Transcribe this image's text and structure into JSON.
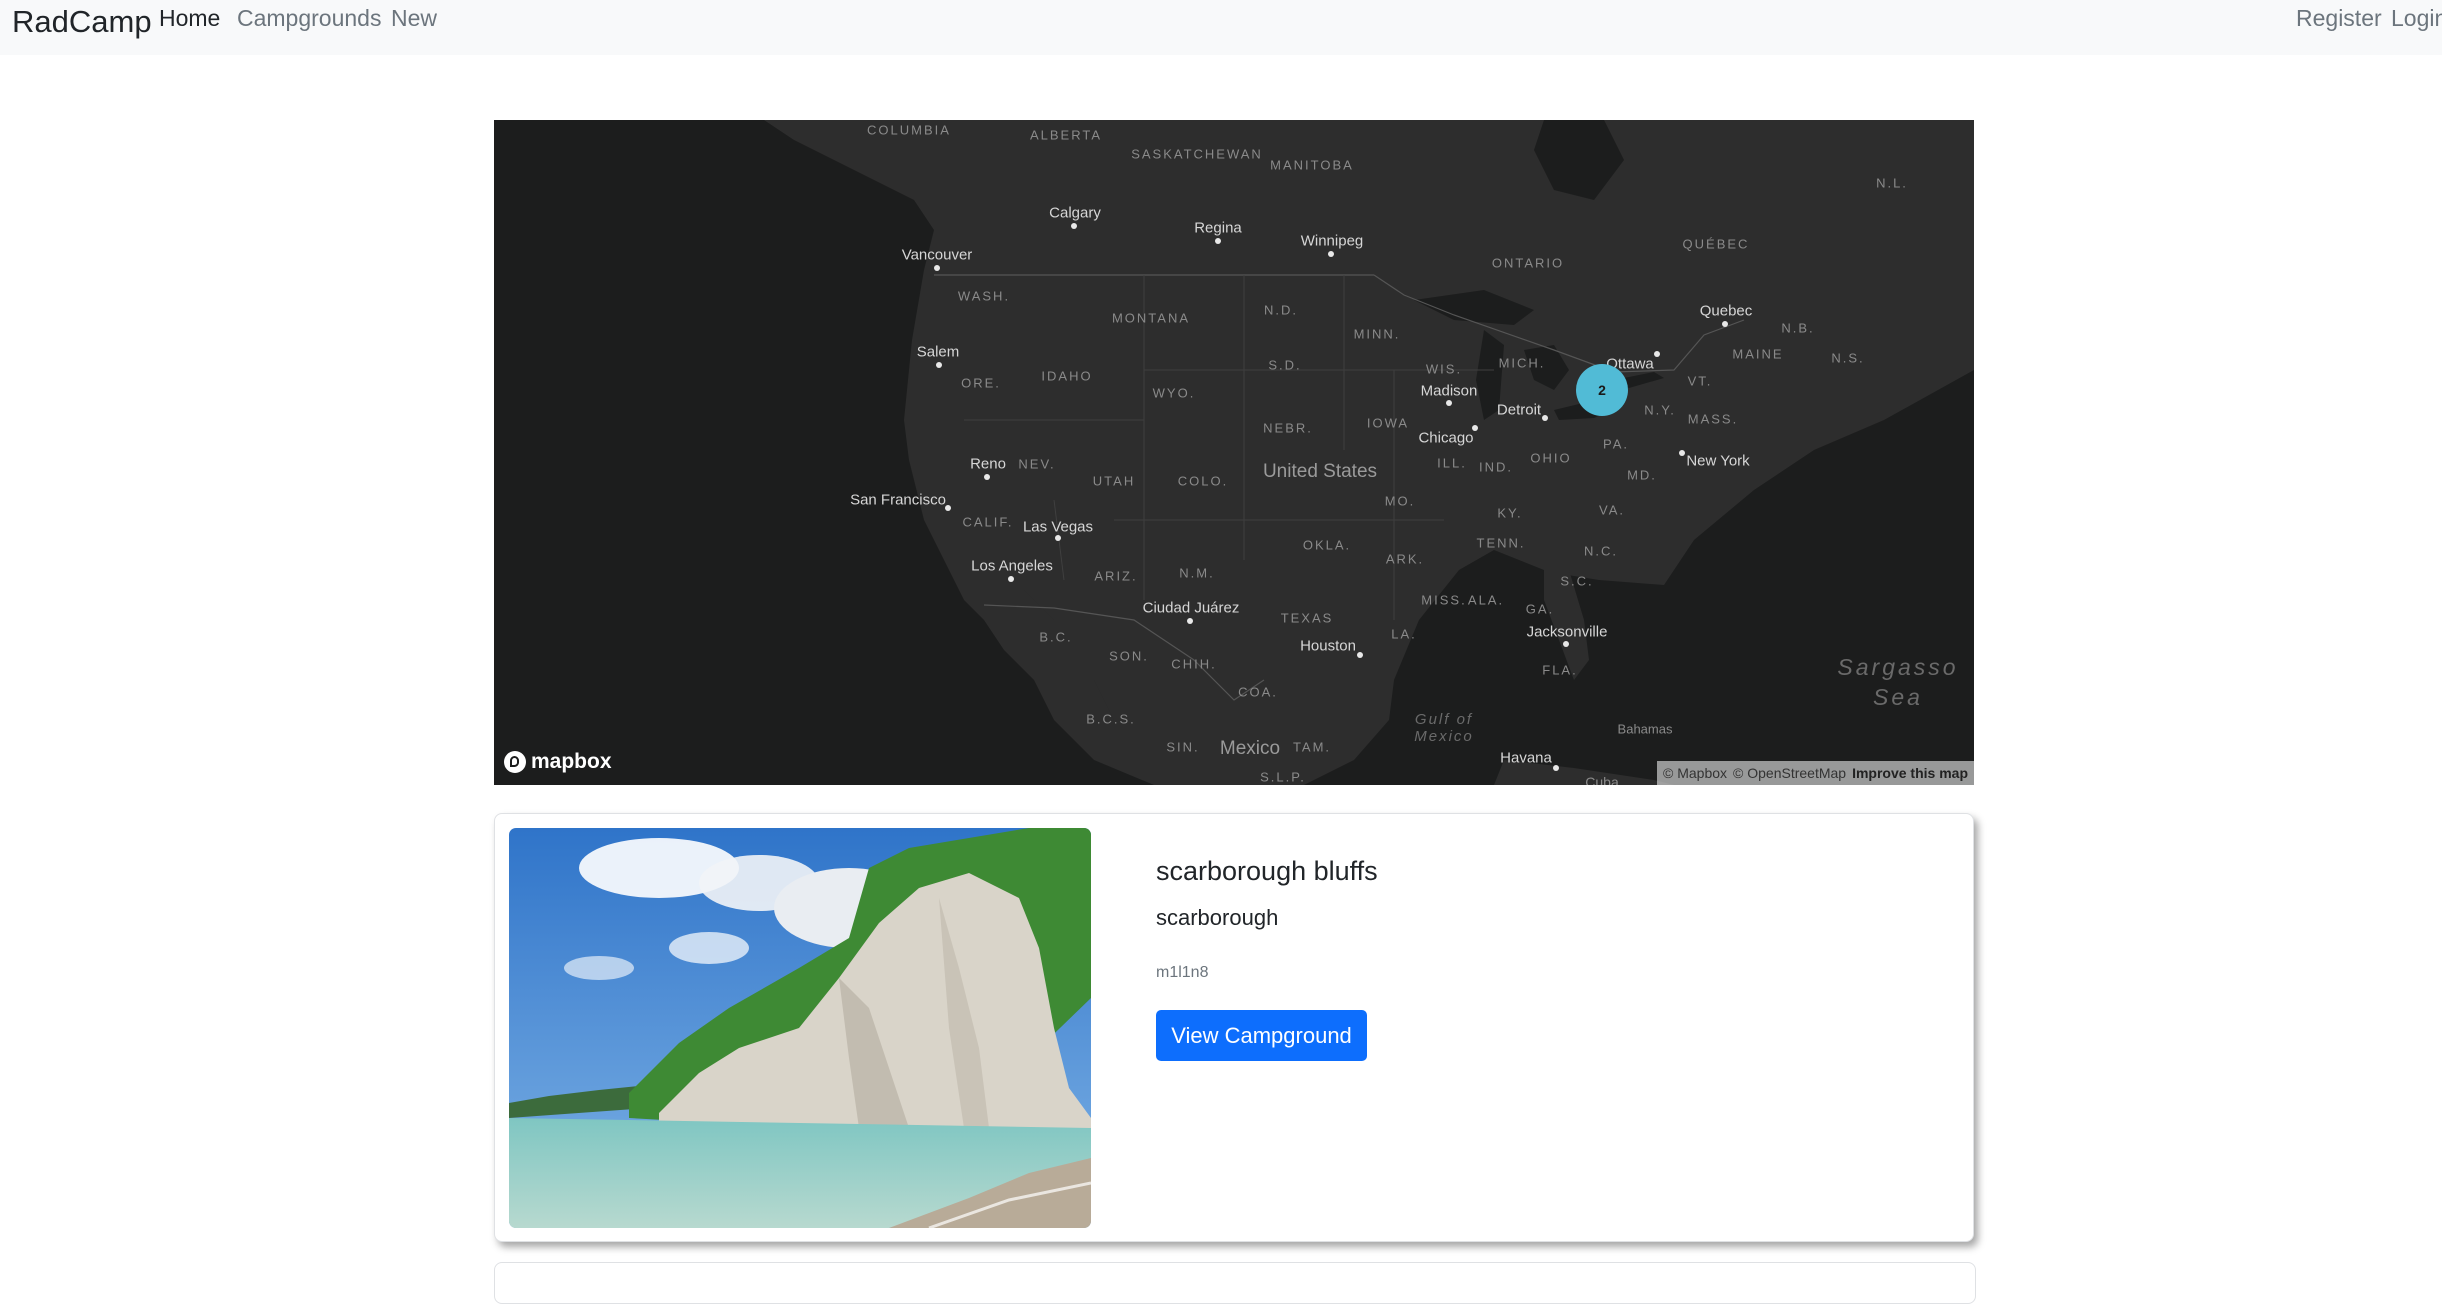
{
  "navbar": {
    "brand": "RadCamp",
    "links": [
      {
        "label": "Home",
        "active": true
      },
      {
        "label": "Campgrounds",
        "active": false
      },
      {
        "label": "New",
        "active": false
      }
    ],
    "auth": [
      {
        "label": "Register"
      },
      {
        "label": "Login"
      }
    ]
  },
  "map": {
    "style": "dark",
    "background_color": "#1c1d1d",
    "land_color": "#2d2d2d",
    "cluster": {
      "count": "2",
      "color": "#51bbd6"
    },
    "labels": {
      "states": [
        "COLUMBIA",
        "ALBERTA",
        "SASKATCHEWAN",
        "MANITOBA",
        "ONTARIO",
        "QUÉBEC",
        "N.L.",
        "WASH.",
        "MONTANA",
        "N.D.",
        "MINN.",
        "ORE.",
        "IDAHO",
        "WYO.",
        "S.D.",
        "WIS.",
        "MICH.",
        "MAINE",
        "N.B.",
        "N.S.",
        "VT.",
        "N.Y.",
        "MASS.",
        "NEBR.",
        "IOWA",
        "NEV.",
        "UTAH",
        "COLO.",
        "ILL.",
        "IND.",
        "OHIO",
        "PA.",
        "MD.",
        "CALIF.",
        "MO.",
        "KY.",
        "VA.",
        "OKLA.",
        "ARIZ.",
        "N.M.",
        "ARK.",
        "TENN.",
        "N.C.",
        "S.C.",
        "MISS.",
        "ALA.",
        "GA.",
        "TEXAS",
        "LA.",
        "FLA.",
        "B.C.",
        "SON.",
        "CHIH.",
        "COA.",
        "B.C.S.",
        "SIN.",
        "TAM.",
        "S.L.P."
      ],
      "cities": [
        "Calgary",
        "Regina",
        "Winnipeg",
        "Vancouver",
        "Quebec",
        "Ottawa",
        "Salem",
        "Madison",
        "Detroit",
        "Chicago",
        "New York",
        "Reno",
        "San Francisco",
        "Las Vegas",
        "Los Angeles",
        "Ciudad Juárez",
        "Houston",
        "Jacksonville",
        "Havana",
        "Bahamas",
        "Cuba"
      ],
      "country_us": "United States",
      "country_mx": "Mexico",
      "gulf": [
        "Gulf of",
        "Mexico"
      ],
      "sea": [
        "Sargasso",
        "Sea"
      ]
    },
    "logo": "mapbox",
    "attribution": {
      "mapbox": "© Mapbox",
      "osm": "© OpenStreetMap",
      "improve": "Improve this map"
    }
  },
  "campground": {
    "title": "scarborough bluffs",
    "location": "scarborough",
    "author": "m1l1n8",
    "button_label": "View Campground",
    "button_color": "#0d6efd"
  }
}
